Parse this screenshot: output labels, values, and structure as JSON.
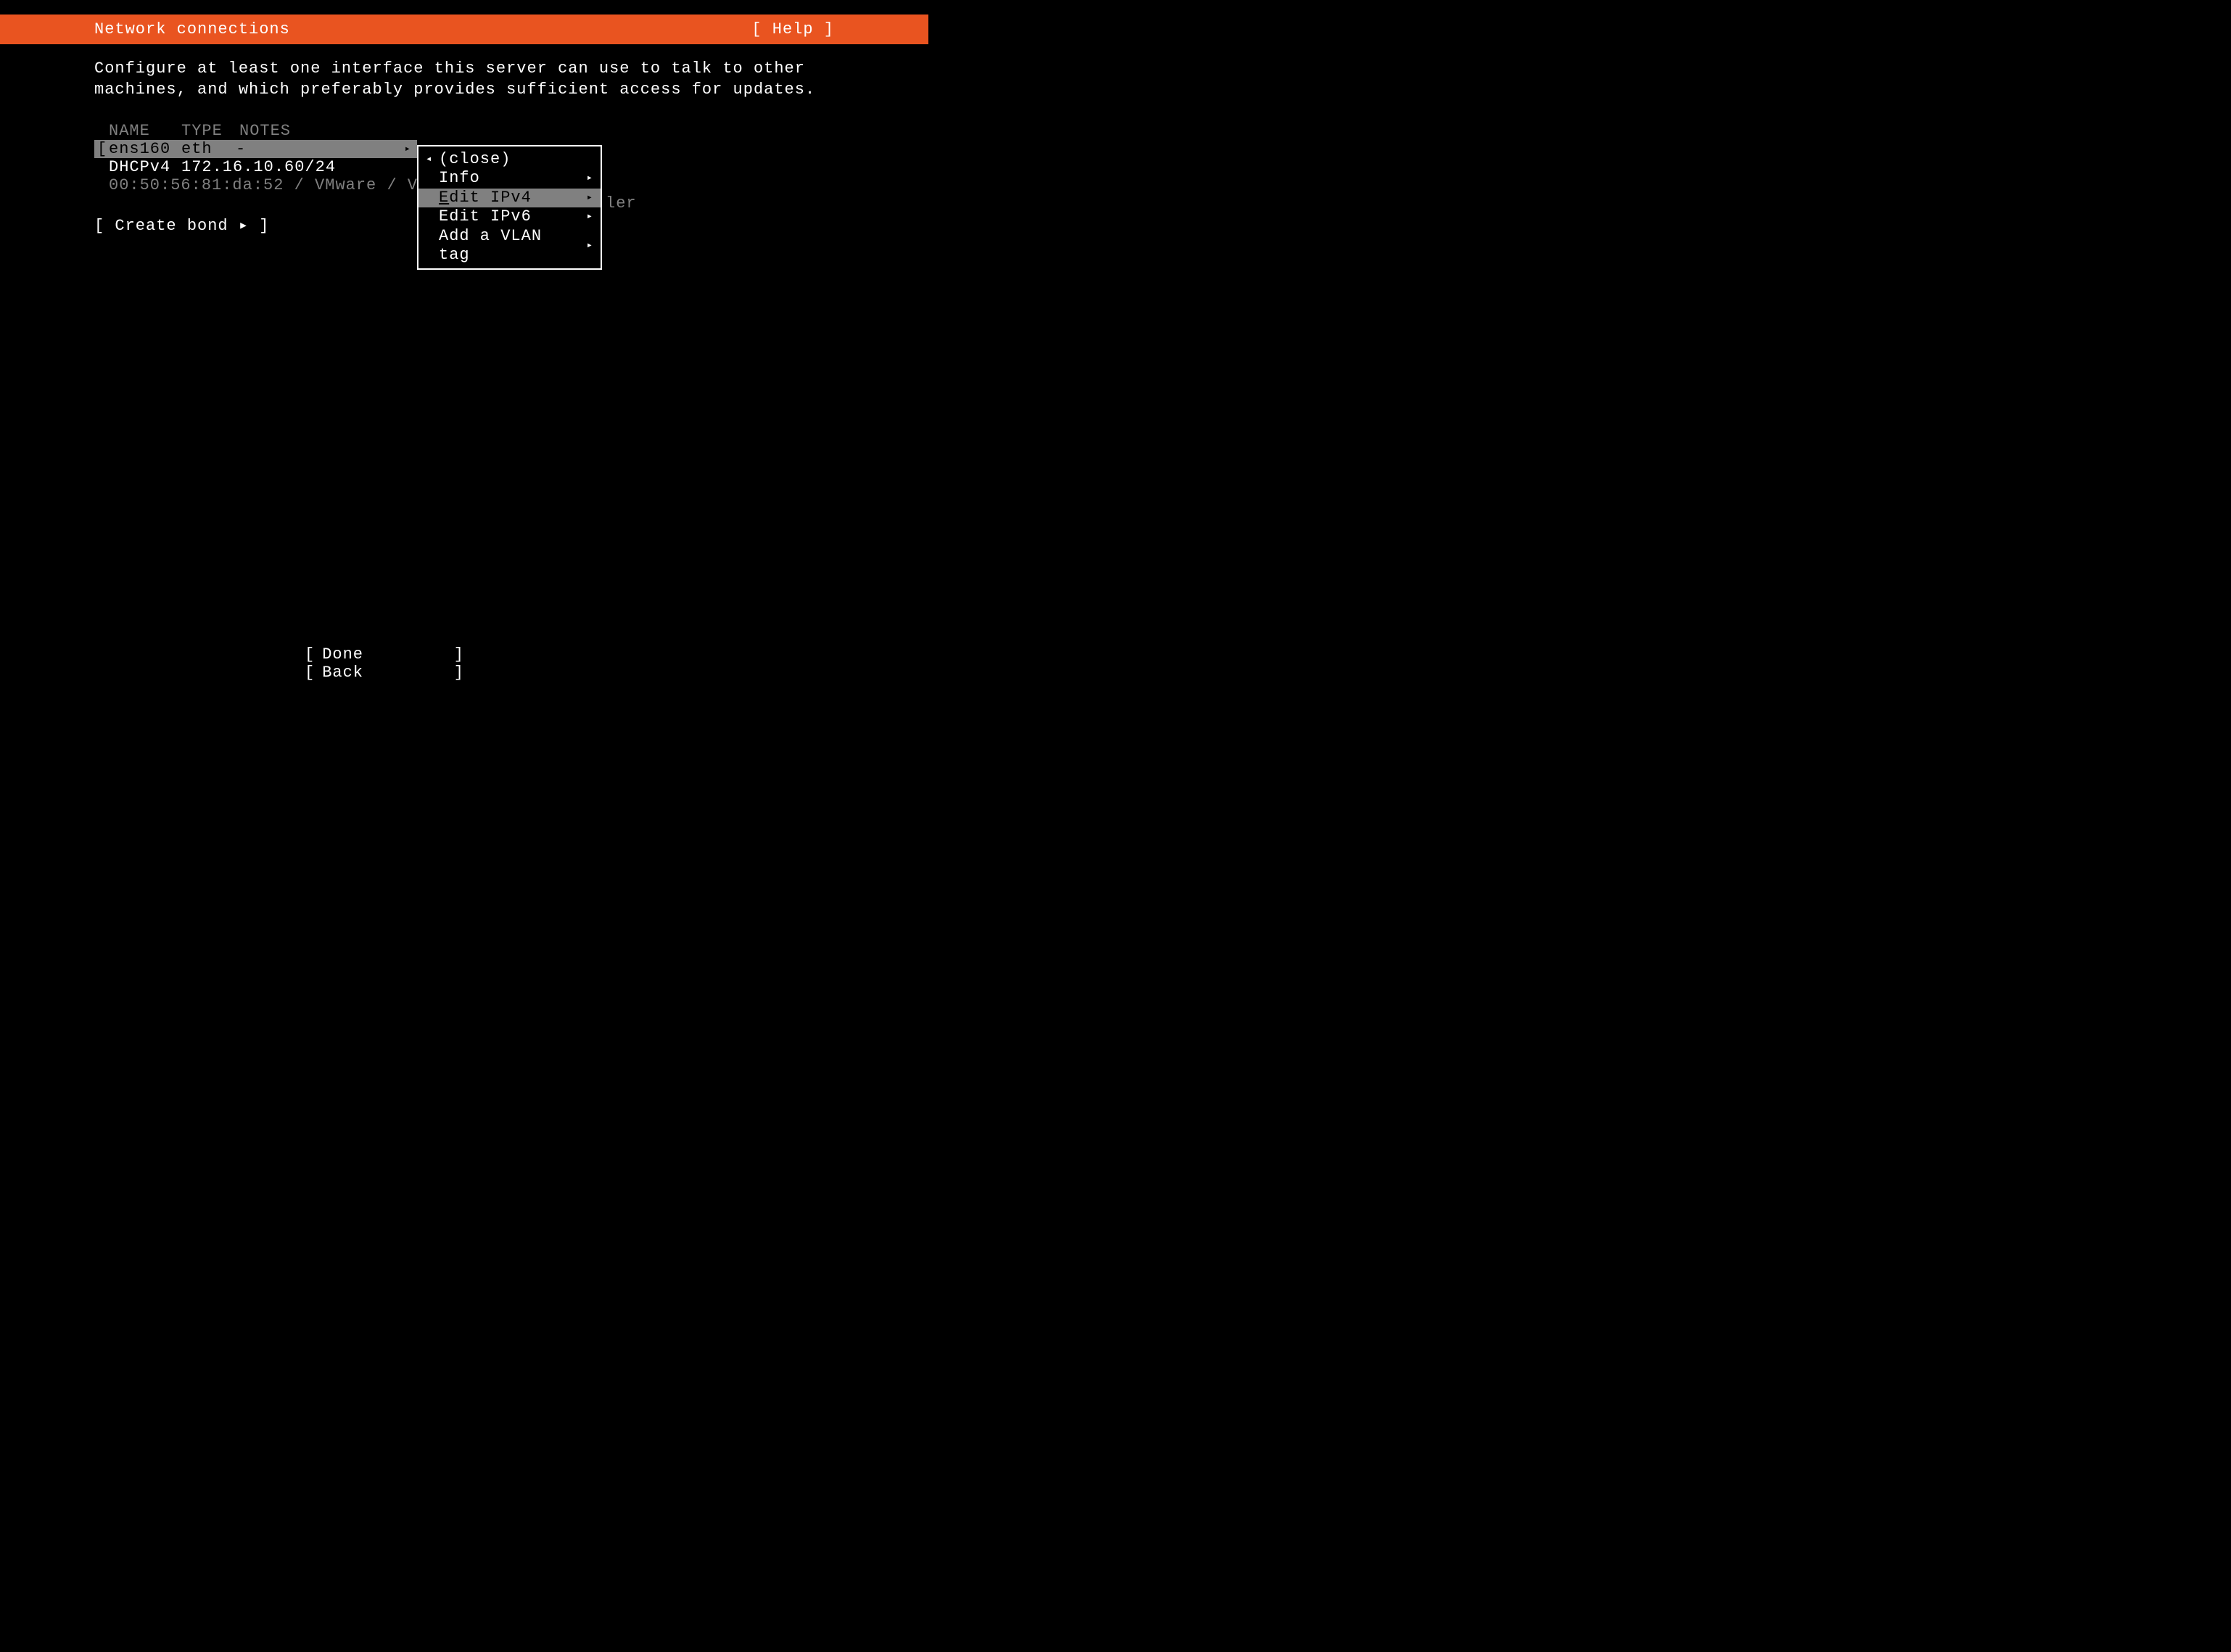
{
  "header": {
    "title": "Network connections",
    "help": "[ Help ]"
  },
  "description": "Configure at least one interface this server can use to talk to other machines, and which preferably provides sufficient access for updates.",
  "columns": {
    "name": "NAME",
    "type": "TYPE",
    "notes": "NOTES"
  },
  "interface": {
    "bracket_l": "[",
    "name": "ens160",
    "type": "eth",
    "notes": "-",
    "arrow": "▸"
  },
  "dhcp": {
    "label": "DHCPv4",
    "value": "172.16.10.60/24"
  },
  "mac": "00:50:56:81:da:52 / VMware / VMX",
  "mac_tail": "ler",
  "create_bond": "[ Create bond ▸ ]",
  "popup": {
    "close": {
      "arrow_l": "◂",
      "label": "(close)",
      "arrow_r": ""
    },
    "info": {
      "arrow_l": "",
      "label": "Info",
      "arrow_r": "▸"
    },
    "ipv4": {
      "arrow_l": "",
      "label_e": "E",
      "label_rest": "dit IPv4",
      "arrow_r": "▸"
    },
    "ipv6": {
      "arrow_l": "",
      "label": "Edit IPv6",
      "arrow_r": "▸"
    },
    "vlan": {
      "arrow_l": "",
      "label": "Add a VLAN tag",
      "arrow_r": "▸"
    }
  },
  "footer": {
    "done": {
      "l": "[",
      "label": "Done",
      "r": "]"
    },
    "back": {
      "l": "[",
      "label": "Back",
      "r": "]"
    }
  }
}
